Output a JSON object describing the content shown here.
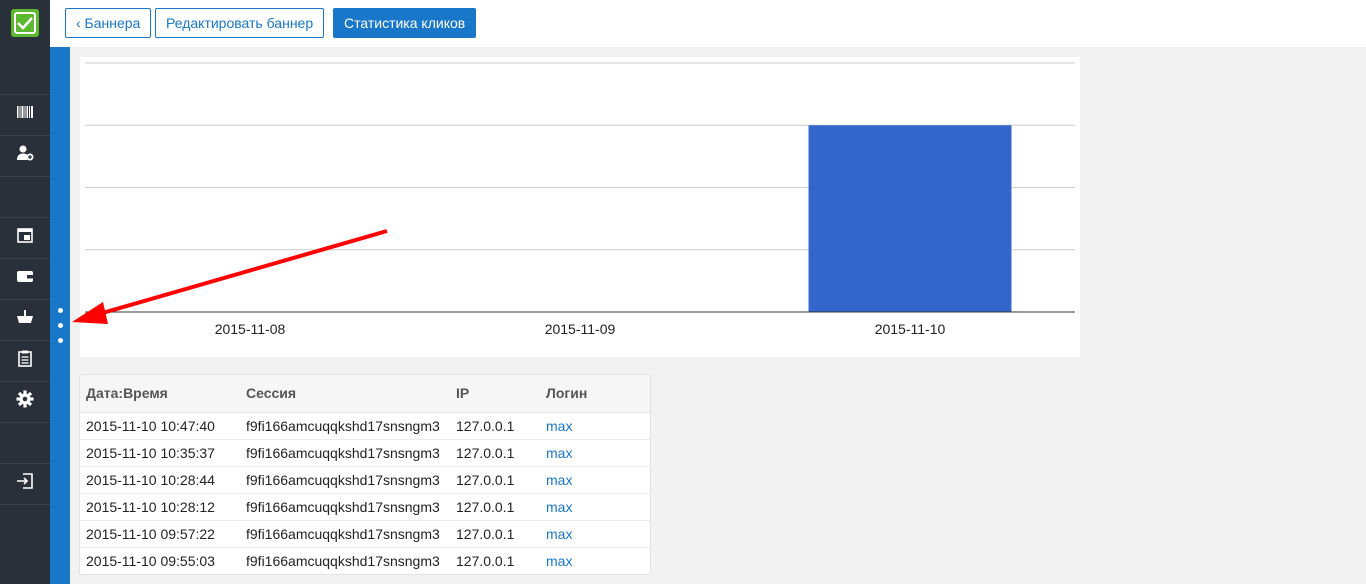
{
  "toolbar": {
    "back_label": "‹ Баннера",
    "edit_label": "Редактировать баннер",
    "stats_label": "Статистика кликов"
  },
  "sidebar": {
    "items": [
      {
        "icon": "barcode-icon"
      },
      {
        "icon": "add-user-icon"
      },
      {
        "icon": "calendar-icon"
      },
      {
        "icon": "wallet-icon"
      },
      {
        "icon": "basket-icon"
      },
      {
        "icon": "clipboard-icon"
      },
      {
        "icon": "gear-icon"
      },
      {
        "icon": "logout-icon"
      }
    ]
  },
  "colors": {
    "accent": "#1877c9",
    "bar": "#3366cc",
    "sidebar_bg": "#2a3039",
    "logo_green": "#5cb82e",
    "arrow": "#ff0000"
  },
  "chart_data": {
    "type": "bar",
    "categories": [
      "2015-11-08",
      "2015-11-09",
      "2015-11-10"
    ],
    "values": [
      0,
      0,
      6
    ],
    "ylim": [
      0,
      8
    ],
    "grid": true,
    "y_tick_labels_shown": false
  },
  "table": {
    "headers": [
      "Дата:Время",
      "Сессия",
      "IP",
      "Логин"
    ],
    "rows": [
      [
        "2015-11-10 10:47:40",
        "f9fi166amcuqqkshd17snsngm3",
        "127.0.0.1",
        "max"
      ],
      [
        "2015-11-10 10:35:37",
        "f9fi166amcuqqkshd17snsngm3",
        "127.0.0.1",
        "max"
      ],
      [
        "2015-11-10 10:28:44",
        "f9fi166amcuqqkshd17snsngm3",
        "127.0.0.1",
        "max"
      ],
      [
        "2015-11-10 10:28:12",
        "f9fi166amcuqqkshd17snsngm3",
        "127.0.0.1",
        "max"
      ],
      [
        "2015-11-10 09:57:22",
        "f9fi166amcuqqkshd17snsngm3",
        "127.0.0.1",
        "max"
      ],
      [
        "2015-11-10 09:55:03",
        "f9fi166amcuqqkshd17snsngm3",
        "127.0.0.1",
        "max"
      ]
    ]
  }
}
